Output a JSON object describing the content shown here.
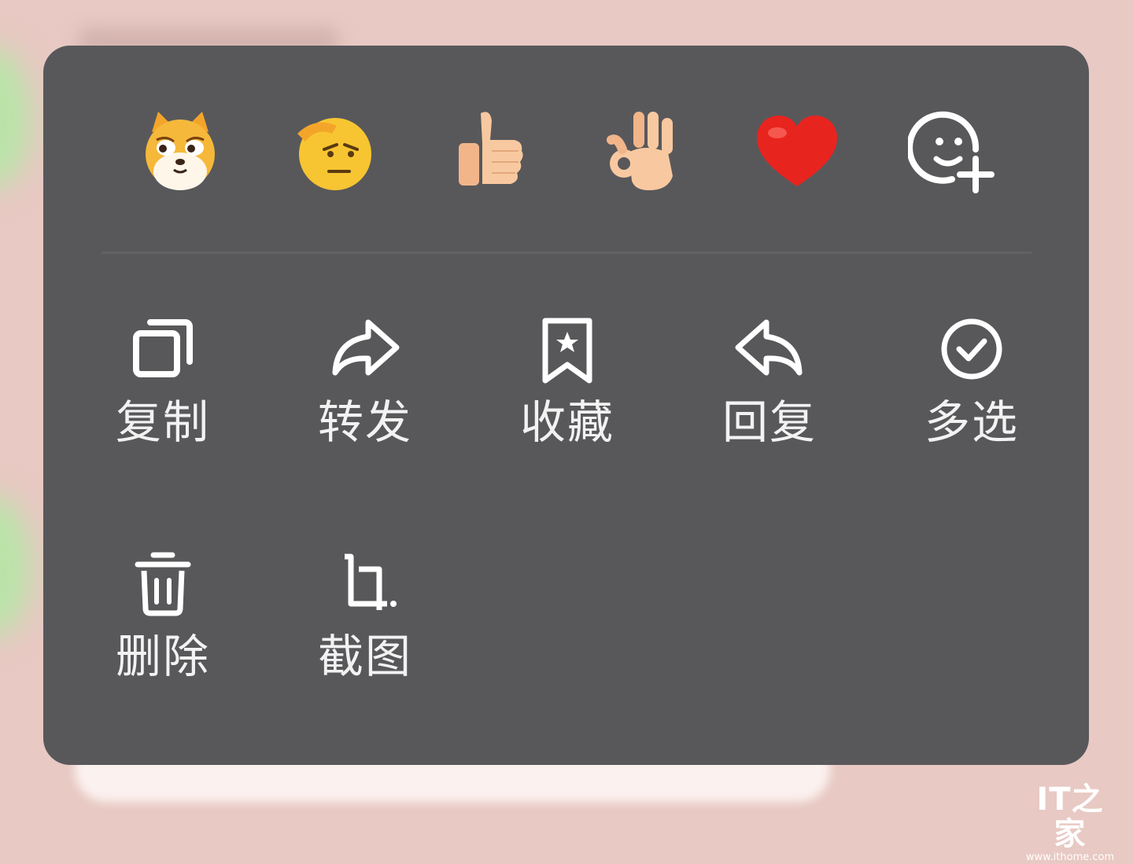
{
  "reactions": [
    {
      "name": "shiba-dog-emoji"
    },
    {
      "name": "salute-face-emoji"
    },
    {
      "name": "thumbs-up-emoji"
    },
    {
      "name": "ok-hand-emoji"
    },
    {
      "name": "red-heart-emoji"
    },
    {
      "name": "add-emoji-icon"
    }
  ],
  "actions": {
    "copy": {
      "label": "复制",
      "icon": "copy-icon"
    },
    "forward": {
      "label": "转发",
      "icon": "forward-arrow-icon"
    },
    "favorite": {
      "label": "收藏",
      "icon": "bookmark-star-icon"
    },
    "reply": {
      "label": "回复",
      "icon": "reply-arrow-icon"
    },
    "multi_select": {
      "label": "多选",
      "icon": "check-circle-icon"
    },
    "delete": {
      "label": "删除",
      "icon": "trash-icon"
    },
    "screenshot": {
      "label": "截图",
      "icon": "crop-icon"
    }
  },
  "watermark": {
    "logo": "IT之家",
    "url": "www.ithome.com"
  },
  "colors": {
    "panel": "#58585b",
    "background": "#e8c9c3",
    "text": "#f2f2f2"
  }
}
